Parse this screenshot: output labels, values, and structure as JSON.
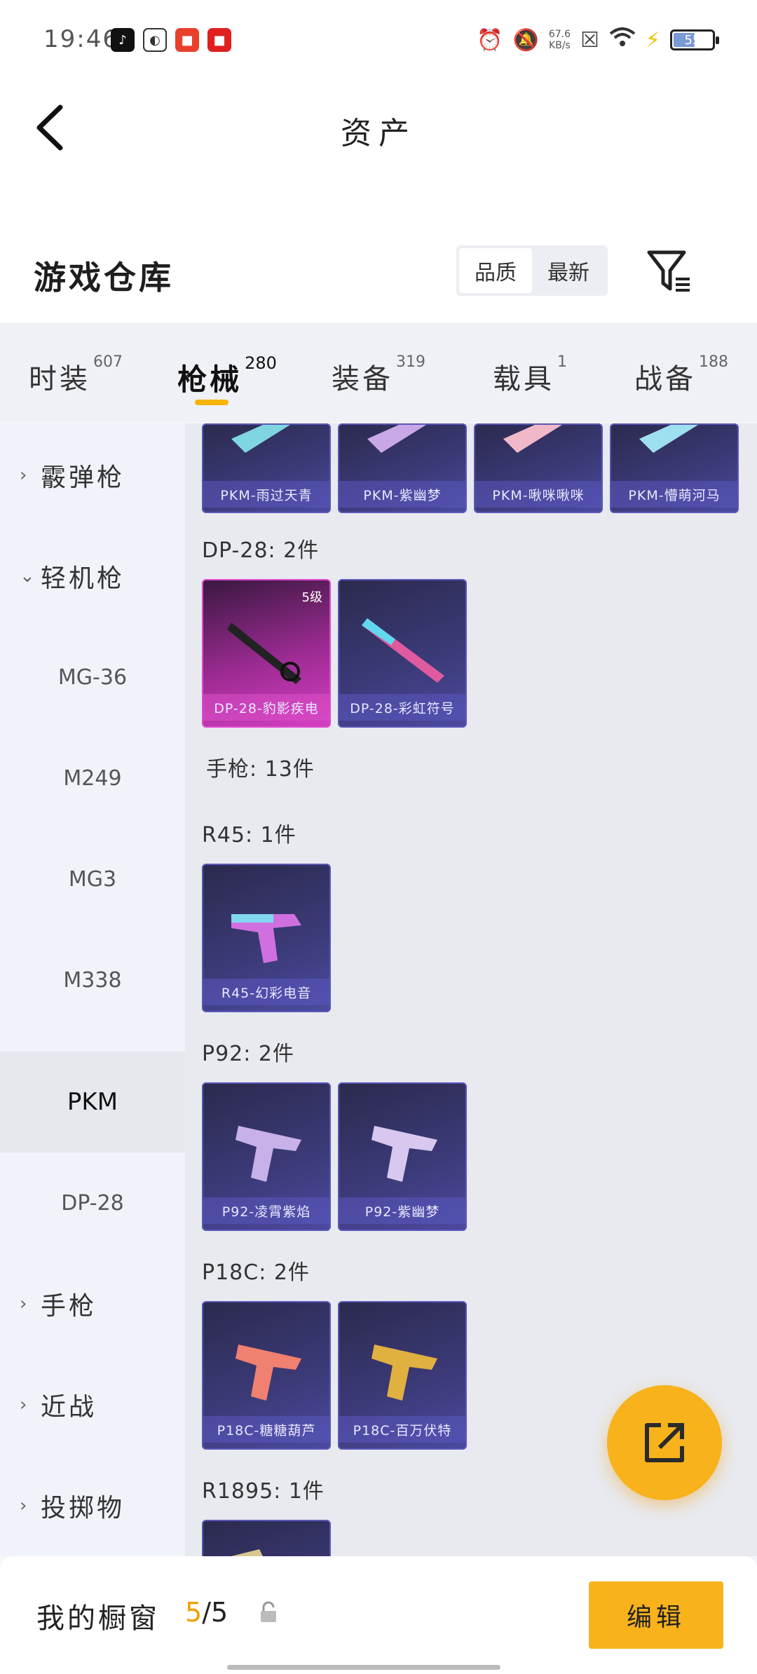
{
  "status_bar": {
    "time": "19:46",
    "net_speed": "67.6",
    "net_unit": "KB/s",
    "battery": "55"
  },
  "header": {
    "title": "资产"
  },
  "warehouse": {
    "title": "游戏仓库",
    "sort_options": [
      "品质",
      "最新"
    ]
  },
  "tabs": [
    {
      "label": "时装",
      "count": "607"
    },
    {
      "label": "枪械",
      "count": "280"
    },
    {
      "label": "装备",
      "count": "319"
    },
    {
      "label": "载具",
      "count": "1"
    },
    {
      "label": "战备",
      "count": "188"
    }
  ],
  "sidebar": {
    "shotgun": "霰弹枪",
    "lmg": "轻机枪",
    "mg36": "MG-36",
    "m249": "M249",
    "mg3": "MG3",
    "m338": "M338",
    "pkm": "PKM",
    "dp28": "DP-28",
    "pistol": "手枪",
    "melee": "近战",
    "throwable": "投掷物"
  },
  "content": {
    "pkm_cards": [
      "PKM-雨过天青",
      "PKM-紫幽梦",
      "PKM-啾咪啾咪",
      "PKM-懵萌河马"
    ],
    "dp28_label": "DP-28: 2件",
    "dp28_cards": [
      "DP-28-豹影疾电",
      "DP-28-彩虹符号"
    ],
    "dp28_grade": "5级",
    "pistol_label": "手枪: 13件",
    "r45_label": "R45: 1件",
    "r45_cards": [
      "R45-幻彩电音"
    ],
    "p92_label": "P92: 2件",
    "p92_cards": [
      "P92-凌霄紫焰",
      "P92-紫幽梦"
    ],
    "p18c_label": "P18C: 2件",
    "p18c_cards": [
      "P18C-糖糖葫芦",
      "P18C-百万伏特"
    ],
    "r1895_label": "R1895: 1件"
  },
  "bottom": {
    "showcase_label": "我的橱窗",
    "count_current": "5",
    "count_total": "/5",
    "edit_label": "编辑"
  },
  "colors": {
    "accent": "#f7b21c",
    "card_purple": "#3c3b7a",
    "card_pink": "#d43fc2"
  }
}
